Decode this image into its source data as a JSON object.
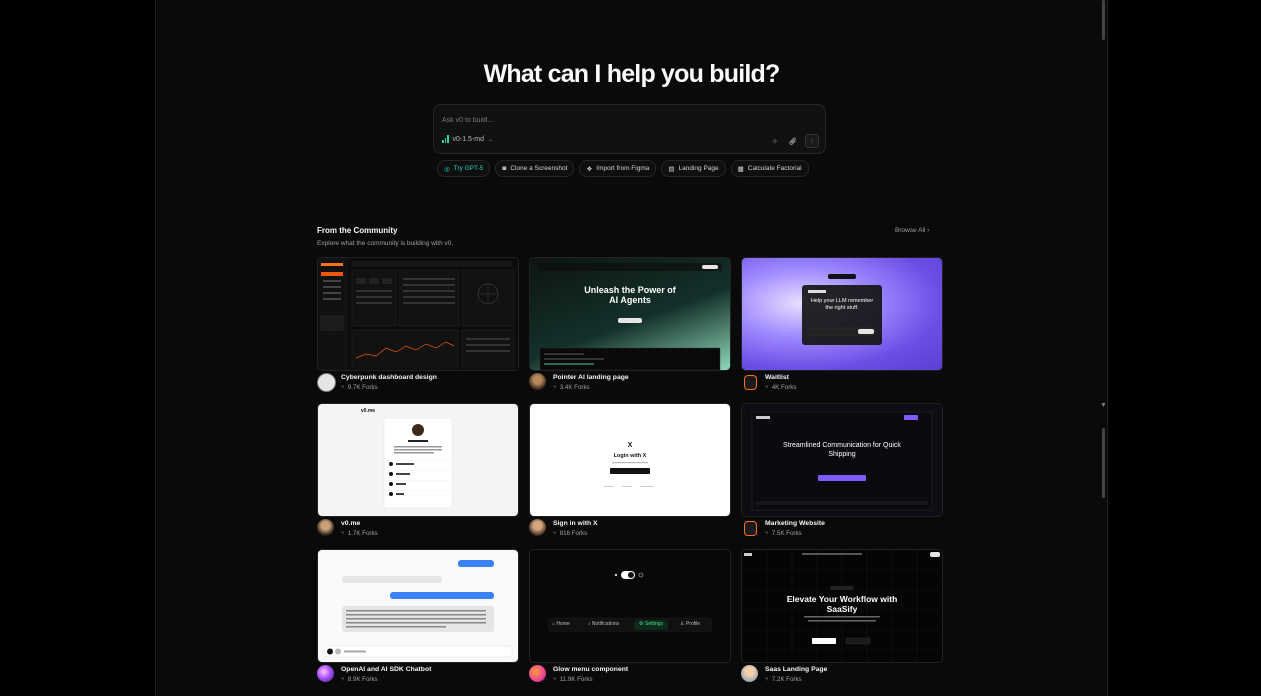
{
  "hero": {
    "title": "What can I help you build?"
  },
  "prompt": {
    "placeholder": "Ask v0 to build...",
    "model": "v0-1.5-md"
  },
  "chips": [
    {
      "label": "Try GPT-5",
      "icon": "sparkle-icon"
    },
    {
      "label": "Clone a Screenshot",
      "icon": "camera-icon"
    },
    {
      "label": "Import from Figma",
      "icon": "figma-icon"
    },
    {
      "label": "Landing Page",
      "icon": "layout-icon"
    },
    {
      "label": "Calculate Factorial",
      "icon": "calculator-icon"
    }
  ],
  "community": {
    "title": "From the Community",
    "subtitle": "Explore what the community is building with v0.",
    "browse_label": "Browse All"
  },
  "cards": [
    {
      "title": "Cyberpunk dashboard design",
      "forks": "9.7K Forks"
    },
    {
      "title": "Pointer AI landing page",
      "forks": "3.4K Forks",
      "thumb_heading": "Unleash the Power of AI Agents"
    },
    {
      "title": "Waitlist",
      "forks": "4K Forks",
      "thumb_heading": "Help your LLM remember the right stuff."
    },
    {
      "title": "v0.me",
      "forks": "1.7K Forks",
      "thumb_heading": "v0.me"
    },
    {
      "title": "Sign in with X",
      "forks": "816 Forks",
      "thumb_heading": "Login with X"
    },
    {
      "title": "Marketing Website",
      "forks": "7.5K Forks",
      "thumb_heading": "Streamlined Communication for Quick Shipping"
    },
    {
      "title": "OpenAI and AI SDK Chatbot",
      "forks": "8.9K Forks"
    },
    {
      "title": "Glow menu component",
      "forks": "11.9K Forks",
      "menu": [
        "Home",
        "Notifications",
        "Settings",
        "Profile"
      ]
    },
    {
      "title": "Saas Landing Page",
      "forks": "7.2K Forks",
      "thumb_heading": "Elevate Your Workflow with SaaSify"
    }
  ],
  "colors": {
    "accent_teal": "#2dd4bf",
    "bg": "#0a0a0a",
    "purple": "#7c5cff"
  }
}
